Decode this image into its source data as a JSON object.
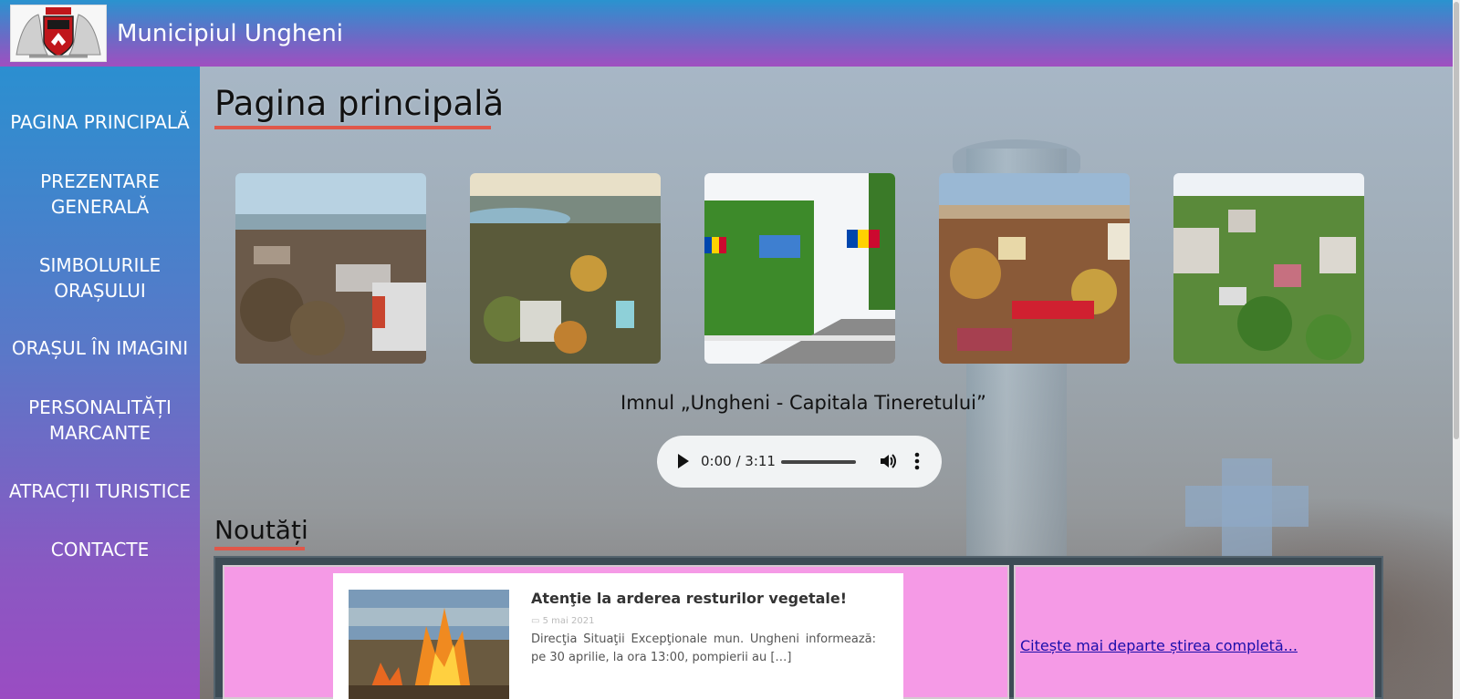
{
  "header": {
    "site_title": "Municipiul Ungheni",
    "logo_icon": "coat-of-arms-icon"
  },
  "sidebar": {
    "items": [
      {
        "label": "PAGINA PRINCIPALĂ"
      },
      {
        "label": "PREZENTARE GENERALĂ"
      },
      {
        "label": "SIMBOLURILE ORAȘULUI"
      },
      {
        "label": "ORAȘUL ÎN IMAGINI"
      },
      {
        "label": "PERSONALITĂȚI MARCANTE"
      },
      {
        "label": "ATRACȚII TURISTICE"
      },
      {
        "label": "CONTACTE"
      }
    ]
  },
  "main": {
    "page_title": "Pagina principală",
    "gallery": [
      {
        "name": "city-photo-1"
      },
      {
        "name": "city-photo-2"
      },
      {
        "name": "city-photo-3"
      },
      {
        "name": "city-photo-4"
      },
      {
        "name": "city-photo-5"
      }
    ],
    "anthem_title": "Imnul „Ungheni - Capitala Tineretului”",
    "audio": {
      "time": "0:00 / 3:11"
    },
    "news_title": "Noutăți",
    "news": {
      "title": "Atenţie la arderea resturilor vegetale!",
      "date": "5 mai 2021",
      "excerpt": "Direcţia Situaţii Excepţionale mun. Ungheni informează: pe 30 aprilie, la ora 13:00, pompierii au […]",
      "read_more": "Citește mai departe știrea completă..."
    }
  },
  "colors": {
    "accent_underline": "#e0574a",
    "news_cell": "#f59ae6",
    "link": "#1a0dab"
  }
}
